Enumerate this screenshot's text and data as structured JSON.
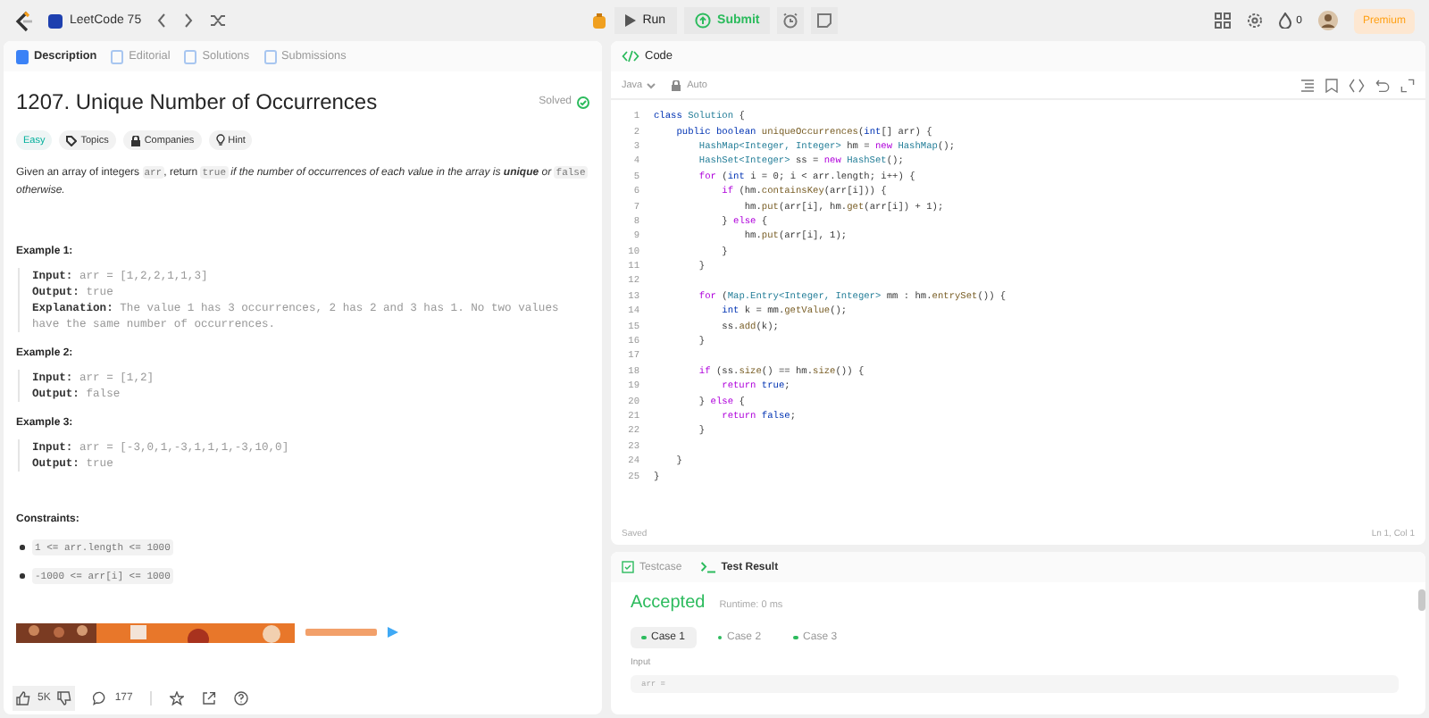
{
  "topbar": {
    "list_title": "LeetCode 75",
    "run": "Run",
    "submit": "Submit",
    "streak": "0",
    "premium": "Premium"
  },
  "left_tabs": [
    {
      "label": "Description",
      "selected": true
    },
    {
      "label": "Editorial",
      "selected": false
    },
    {
      "label": "Solutions",
      "selected": false
    },
    {
      "label": "Submissions",
      "selected": false
    }
  ],
  "problem": {
    "title": "1207. Unique Number of Occurrences",
    "status": "Solved",
    "difficulty": "Easy",
    "tags": [
      "Topics",
      "Companies",
      "Hint"
    ],
    "description": [
      {
        "kind": "text",
        "text": "Given an array of integers "
      },
      {
        "kind": "code",
        "text": "arr"
      },
      {
        "kind": "text",
        "text": ", return "
      },
      {
        "kind": "code",
        "text": "true"
      },
      {
        "kind": "em",
        "text": " if the number of occurrences of each value in the array is "
      },
      {
        "kind": "strong",
        "text": "unique"
      },
      {
        "kind": "em",
        "text": " or "
      },
      {
        "kind": "code",
        "text": "false"
      },
      {
        "kind": "em",
        "text": " otherwise."
      }
    ],
    "examples": [
      {
        "title": "Example 1:",
        "lines": [
          {
            "label": "Input:",
            "value": "arr = [1,2,2,1,1,3]"
          },
          {
            "label": "Output:",
            "value": "true"
          },
          {
            "label": "Explanation:",
            "value": "The value 1 has 3 occurrences, 2 has 2 and 3 has 1. No two values have the same number of occurrences."
          }
        ]
      },
      {
        "title": "Example 2:",
        "lines": [
          {
            "label": "Input:",
            "value": "arr = [1,2]"
          },
          {
            "label": "Output:",
            "value": "false"
          }
        ]
      },
      {
        "title": "Example 3:",
        "lines": [
          {
            "label": "Input:",
            "value": "arr = [-3,0,1,-3,1,1,1,-3,10,0]"
          },
          {
            "label": "Output:",
            "value": "true"
          }
        ]
      }
    ],
    "constraints_title": "Constraints:",
    "constraints": [
      "1 <= arr.length <= 1000",
      "-1000 <= arr[i] <= 1000"
    ]
  },
  "actions": {
    "likes": "5K",
    "comments": "177"
  },
  "code_panel": {
    "title": "Code",
    "language": "Java",
    "mode": "Auto",
    "save_status": "Saved",
    "cursor": "Ln 1, Col 1",
    "lines": [
      {
        "n": "1",
        "tokens": [
          {
            "kind": "keyword",
            "text": "class "
          },
          {
            "kind": "type",
            "text": "Solution"
          },
          {
            "kind": "plain",
            "text": " {"
          }
        ]
      },
      {
        "n": "2",
        "tokens": [
          {
            "kind": "keyword",
            "text": "    public boolean "
          },
          {
            "kind": "method",
            "text": "uniqueOccurrences"
          },
          {
            "kind": "plain",
            "text": "("
          },
          {
            "kind": "keyword",
            "text": "int"
          },
          {
            "kind": "plain",
            "text": "[] arr) {"
          }
        ]
      },
      {
        "n": "3",
        "tokens": [
          {
            "kind": "type",
            "text": "        HashMap<Integer, Integer>"
          },
          {
            "kind": "plain",
            "text": " hm = "
          },
          {
            "kind": "control",
            "text": "new "
          },
          {
            "kind": "type",
            "text": "HashMap"
          },
          {
            "kind": "plain",
            "text": "();"
          }
        ]
      },
      {
        "n": "4",
        "tokens": [
          {
            "kind": "type",
            "text": "        HashSet<Integer>"
          },
          {
            "kind": "plain",
            "text": " ss = "
          },
          {
            "kind": "control",
            "text": "new "
          },
          {
            "kind": "type",
            "text": "HashSet"
          },
          {
            "kind": "plain",
            "text": "();"
          }
        ]
      },
      {
        "n": "5",
        "tokens": [
          {
            "kind": "control",
            "text": "        for "
          },
          {
            "kind": "plain",
            "text": "("
          },
          {
            "kind": "keyword",
            "text": "int"
          },
          {
            "kind": "plain",
            "text": " i = 0; i < arr.length; i++) {"
          }
        ]
      },
      {
        "n": "6",
        "tokens": [
          {
            "kind": "control",
            "text": "            if "
          },
          {
            "kind": "plain",
            "text": "(hm."
          },
          {
            "kind": "method",
            "text": "containsKey"
          },
          {
            "kind": "plain",
            "text": "(arr[i])) {"
          }
        ]
      },
      {
        "n": "7",
        "tokens": [
          {
            "kind": "plain",
            "text": "                hm."
          },
          {
            "kind": "method",
            "text": "put"
          },
          {
            "kind": "plain",
            "text": "(arr[i], hm."
          },
          {
            "kind": "method",
            "text": "get"
          },
          {
            "kind": "plain",
            "text": "(arr[i]) + 1);"
          }
        ]
      },
      {
        "n": "8",
        "tokens": [
          {
            "kind": "plain",
            "text": "            } "
          },
          {
            "kind": "control",
            "text": "else"
          },
          {
            "kind": "plain",
            "text": " {"
          }
        ]
      },
      {
        "n": "9",
        "tokens": [
          {
            "kind": "plain",
            "text": "                hm."
          },
          {
            "kind": "method",
            "text": "put"
          },
          {
            "kind": "plain",
            "text": "(arr[i], 1);"
          }
        ]
      },
      {
        "n": "10",
        "tokens": [
          {
            "kind": "plain",
            "text": "            }"
          }
        ]
      },
      {
        "n": "11",
        "tokens": [
          {
            "kind": "plain",
            "text": "        }"
          }
        ]
      },
      {
        "n": "12"
      },
      {
        "n": "13",
        "tokens": [
          {
            "kind": "control",
            "text": "        for "
          },
          {
            "kind": "plain",
            "text": "("
          },
          {
            "kind": "type",
            "text": "Map.Entry<Integer, Integer>"
          },
          {
            "kind": "plain",
            "text": " mm : hm."
          },
          {
            "kind": "method",
            "text": "entrySet"
          },
          {
            "kind": "plain",
            "text": "()) {"
          }
        ]
      },
      {
        "n": "14",
        "tokens": [
          {
            "kind": "keyword",
            "text": "            int"
          },
          {
            "kind": "plain",
            "text": " k = mm."
          },
          {
            "kind": "method",
            "text": "getValue"
          },
          {
            "kind": "plain",
            "text": "();"
          }
        ]
      },
      {
        "n": "15",
        "tokens": [
          {
            "kind": "plain",
            "text": "            ss."
          },
          {
            "kind": "method",
            "text": "add"
          },
          {
            "kind": "plain",
            "text": "(k);"
          }
        ]
      },
      {
        "n": "16",
        "tokens": [
          {
            "kind": "plain",
            "text": "        }"
          }
        ]
      },
      {
        "n": "17"
      },
      {
        "n": "18",
        "tokens": [
          {
            "kind": "control",
            "text": "        if "
          },
          {
            "kind": "plain",
            "text": "(ss."
          },
          {
            "kind": "method",
            "text": "size"
          },
          {
            "kind": "plain",
            "text": "() == hm."
          },
          {
            "kind": "method",
            "text": "size"
          },
          {
            "kind": "plain",
            "text": "()) {"
          }
        ]
      },
      {
        "n": "19",
        "tokens": [
          {
            "kind": "control",
            "text": "            return "
          },
          {
            "kind": "keyword",
            "text": "true"
          },
          {
            "kind": "plain",
            "text": ";"
          }
        ]
      },
      {
        "n": "20",
        "tokens": [
          {
            "kind": "plain",
            "text": "        } "
          },
          {
            "kind": "control",
            "text": "else"
          },
          {
            "kind": "plain",
            "text": " {"
          }
        ]
      },
      {
        "n": "21",
        "tokens": [
          {
            "kind": "control",
            "text": "            return "
          },
          {
            "kind": "keyword",
            "text": "false"
          },
          {
            "kind": "plain",
            "text": ";"
          }
        ]
      },
      {
        "n": "22",
        "tokens": [
          {
            "kind": "plain",
            "text": "        }"
          }
        ]
      },
      {
        "n": "23"
      },
      {
        "n": "24",
        "tokens": [
          {
            "kind": "plain",
            "text": "    }"
          }
        ]
      },
      {
        "n": "25",
        "tokens": [
          {
            "kind": "plain",
            "text": "}"
          }
        ]
      }
    ]
  },
  "test_panel": {
    "tabs": [
      {
        "label": "Testcase",
        "selected": false
      },
      {
        "label": "Test Result",
        "selected": true
      }
    ],
    "verdict": "Accepted",
    "runtime": "Runtime: 0 ms",
    "cases": [
      {
        "label": "Case 1",
        "selected": true,
        "passed": true
      },
      {
        "label": "Case 2",
        "selected": false,
        "passed": true
      },
      {
        "label": "Case 3",
        "selected": false,
        "passed": true
      }
    ],
    "input_label": "Input",
    "input_value": "arr ="
  }
}
